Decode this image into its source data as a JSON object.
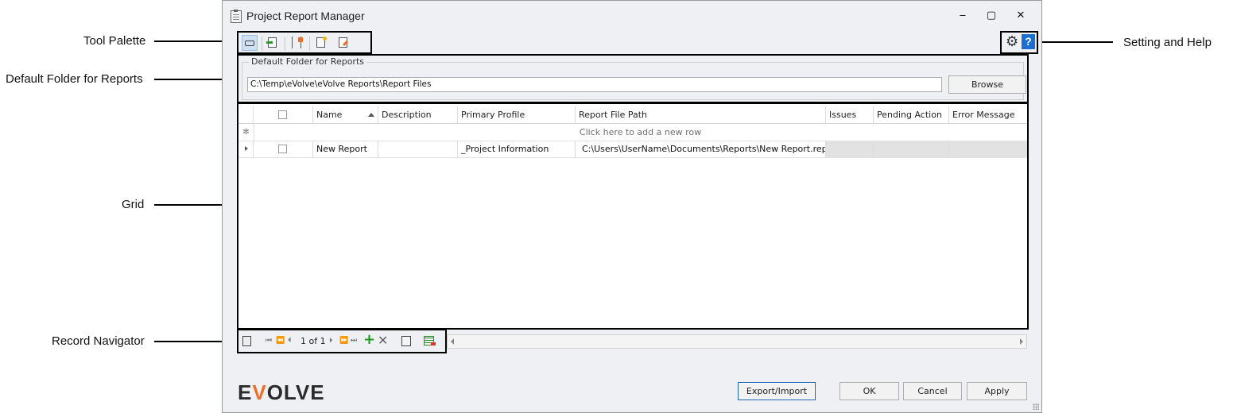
{
  "callouts": {
    "tool_palette": "Tool Palette",
    "default_folder": "Default Folder for Reports",
    "grid": "Grid",
    "record_navigator": "Record Navigator",
    "setting_help": "Setting and Help"
  },
  "window": {
    "title": "Project Report Manager",
    "minimize": "‒",
    "maximize": "▢",
    "close": "✕"
  },
  "toolbar": {
    "icons": [
      "print-icon",
      "export-icon",
      "settings-sliders-icon",
      "new-report-icon",
      "edit-report-icon"
    ]
  },
  "settings": {
    "gear": "⚙",
    "help": "?"
  },
  "default_folder": {
    "legend": "Default Folder for Reports",
    "path": "C:\\Temp\\eVolve\\eVolve Reports\\Report Files",
    "browse_label": "Browse"
  },
  "grid": {
    "columns": [
      "Name",
      "Description",
      "Primary Profile",
      "Report File Path",
      "Issues",
      "Pending Action",
      "Error Message"
    ],
    "new_row_marker": "✻",
    "new_row_text": "Click here to add a new row",
    "rows": [
      {
        "name": "New Report",
        "description": "",
        "primary_profile": "_Project Information",
        "report_file_path": "C:\\Users\\UserName\\Documents\\Reports\\New Report.repx",
        "issues": "",
        "pending_action": "",
        "error_message": ""
      }
    ]
  },
  "navigator": {
    "first": "⏮",
    "prev_page": "⏪",
    "prev": "⏴",
    "count": "1 of 1",
    "next": "⏵",
    "next_page": "⏩",
    "last": "⏭",
    "add": "+",
    "delete": "✕"
  },
  "logo": {
    "part1": "E",
    "part2": "V",
    "part3": "OLVE"
  },
  "buttons": {
    "export_import": "Export/Import",
    "ok": "OK",
    "cancel": "Cancel",
    "apply": "Apply"
  }
}
